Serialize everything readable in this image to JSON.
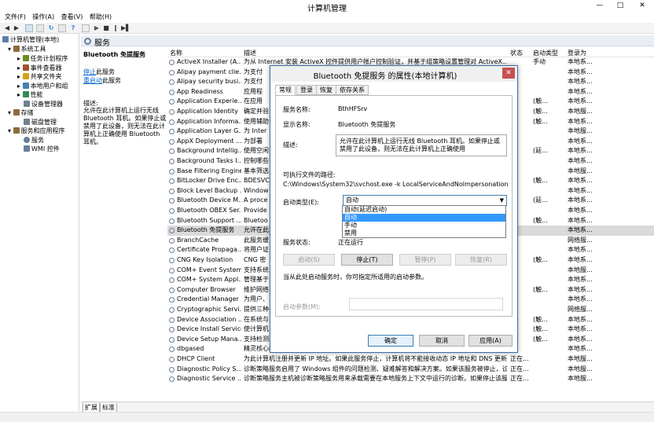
{
  "window": {
    "title": "计算机管理",
    "minimize": "—",
    "maximize": "□",
    "close": "✕"
  },
  "menu": [
    "文件(F)",
    "操作(A)",
    "查看(V)",
    "帮助(H)"
  ],
  "tree": [
    {
      "label": "计算机管理(本地)",
      "indent": 0,
      "color": "#5a7ea8"
    },
    {
      "label": "系统工具",
      "indent": 1,
      "color": "#8a6d3b"
    },
    {
      "label": "任务计划程序",
      "indent": 2,
      "color": "#6b8e23"
    },
    {
      "label": "事件查看器",
      "indent": 2,
      "color": "#a0522d"
    },
    {
      "label": "共享文件夹",
      "indent": 2,
      "color": "#d4a017"
    },
    {
      "label": "本地用户和组",
      "indent": 2,
      "color": "#4682b4"
    },
    {
      "label": "性能",
      "indent": 2,
      "color": "#2e8b57"
    },
    {
      "label": "设备管理器",
      "indent": 2,
      "color": "#708090"
    },
    {
      "label": "存储",
      "indent": 1,
      "color": "#8a6d3b"
    },
    {
      "label": "磁盘管理",
      "indent": 2,
      "color": "#708090"
    },
    {
      "label": "服务和应用程序",
      "indent": 1,
      "color": "#8a6d3b"
    },
    {
      "label": "服务",
      "indent": 2,
      "color": "#6a7f96"
    },
    {
      "label": "WMI 控件",
      "indent": 2,
      "color": "#6a7f96"
    }
  ],
  "services_header": "服务",
  "desc_panel": {
    "title": "Bluetooth 免提服务",
    "stop_link": "停止",
    "stop_suffix": "此服务",
    "restart_link": "重启动",
    "restart_suffix": "此服务",
    "desc_label": "描述:",
    "desc_text": "允许在此计算机上运行无线 Bluetooth 耳机。如果停止或禁用了此设备，则无法在此计算机上正确使用 Bluetooth 耳机。"
  },
  "columns": [
    "名称",
    "描述",
    "状态",
    "启动类型",
    "登录为"
  ],
  "services": [
    {
      "name": "ActiveX Installer (A...",
      "desc": "为从 Internet 安装 ActiveX 控件提供用户帐户控制验证，并基于组策略设置管理对 ActiveX...",
      "status": "",
      "startup": "手动",
      "logon": "本地系..."
    },
    {
      "name": "Alipay payment clie...",
      "desc": "为支付",
      "status": "",
      "startup": "",
      "logon": "本地系..."
    },
    {
      "name": "Alipay security busi...",
      "desc": "为支付",
      "status": "",
      "startup": "",
      "logon": "本地系..."
    },
    {
      "name": "App Readiness",
      "desc": "应用程",
      "status": "",
      "startup": "",
      "logon": "本地系..."
    },
    {
      "name": "Application Experie...",
      "desc": "在应用",
      "status": "",
      "startup": "(触...",
      "logon": "本地系..."
    },
    {
      "name": "Application Identity",
      "desc": "确定并验",
      "status": "",
      "startup": "(触...",
      "logon": "本地服..."
    },
    {
      "name": "Application Informa...",
      "desc": "使用辅助",
      "status": "",
      "startup": "(触...",
      "logon": "本地系..."
    },
    {
      "name": "Application Layer G...",
      "desc": "为 Inter",
      "status": "",
      "startup": "",
      "logon": "本地服..."
    },
    {
      "name": "AppX Deployment ...",
      "desc": "为部署",
      "status": "",
      "startup": "",
      "logon": "本地系..."
    },
    {
      "name": "Background Intellig...",
      "desc": "使用空闲",
      "status": "",
      "startup": "(延...",
      "logon": "本地系..."
    },
    {
      "name": "Background Tasks I...",
      "desc": "控制哪些",
      "status": "",
      "startup": "",
      "logon": "本地系..."
    },
    {
      "name": "Base Filtering Engine",
      "desc": "基本筛选",
      "status": "",
      "startup": "",
      "logon": "本地服..."
    },
    {
      "name": "BitLocker Drive Enc...",
      "desc": "BDESVC",
      "status": "",
      "startup": "(触...",
      "logon": "本地系..."
    },
    {
      "name": "Block Level Backup ...",
      "desc": "Window",
      "status": "",
      "startup": "",
      "logon": "本地系..."
    },
    {
      "name": "Bluetooth Device M...",
      "desc": "A proce",
      "status": "",
      "startup": "(延...",
      "logon": "本地系..."
    },
    {
      "name": "Bluetooth OBEX Ser...",
      "desc": "Provide",
      "status": "",
      "startup": "",
      "logon": "本地系..."
    },
    {
      "name": "Bluetooth Support ...",
      "desc": "Bluetoo",
      "status": "",
      "startup": "(触...",
      "logon": "本地系..."
    },
    {
      "name": "Bluetooth 免提服务",
      "desc": "允许在此",
      "status": "",
      "startup": "",
      "logon": "本地系..."
    },
    {
      "name": "BranchCache",
      "desc": "此服务缓",
      "status": "",
      "startup": "",
      "logon": "网络服..."
    },
    {
      "name": "Certificate Propaga...",
      "desc": "将用户证",
      "status": "",
      "startup": "",
      "logon": "本地系..."
    },
    {
      "name": "CNG Key Isolation",
      "desc": "CNG 密",
      "status": "",
      "startup": "(触...",
      "logon": "本地系..."
    },
    {
      "name": "COM+ Event System",
      "desc": "支持系统",
      "status": "",
      "startup": "",
      "logon": "本地服..."
    },
    {
      "name": "COM+ System Appl...",
      "desc": "管理基于",
      "status": "",
      "startup": "",
      "logon": "本地系..."
    },
    {
      "name": "Computer Browser",
      "desc": "维护网络",
      "status": "",
      "startup": "(触...",
      "logon": "本地系..."
    },
    {
      "name": "Credential Manager",
      "desc": "为用户、",
      "status": "",
      "startup": "",
      "logon": "本地系..."
    },
    {
      "name": "Cryptographic Servi...",
      "desc": "提供三种",
      "status": "",
      "startup": "",
      "logon": "网络服..."
    },
    {
      "name": "Device Association ...",
      "desc": "在系统与",
      "status": "",
      "startup": "(触...",
      "logon": "本地系..."
    },
    {
      "name": "Device Install Service",
      "desc": "使计算机",
      "status": "",
      "startup": "(触...",
      "logon": "本地系..."
    },
    {
      "name": "Device Setup Mana...",
      "desc": "支持检测、下载和安装与设备相关的软件。如果此服务被禁用，则可能使用过期软件对设备进...",
      "status": "",
      "startup": "(触...",
      "logon": "本地系..."
    },
    {
      "name": "dbgased",
      "desc": "精灵核心组件服务，包括程序完整性校验，服务唤醒，服务通信。",
      "status": "",
      "startup": "",
      "logon": "本地系..."
    },
    {
      "name": "DHCP Client",
      "desc": "为此计算机注册并更新 IP 地址。如果此服务停止，计算机将不能接收动态 IP 地址和 DNS 更新...",
      "status": "正在...",
      "startup": "",
      "logon": "本地服..."
    },
    {
      "name": "Diagnostic Policy S...",
      "desc": "诊断策略服务启用了 Windows 组件的问题检测、疑难解答和解决方案。如果该服务被停止，诊...",
      "status": "正在...",
      "startup": "",
      "logon": "本地服..."
    },
    {
      "name": "Diagnostic Service ...",
      "desc": "诊断策略服务主机被诊断策略服务用来承载需要在本地服务上下文中运行的诊断。如果停止该服务...",
      "status": "正在...",
      "startup": "",
      "logon": "本地服..."
    }
  ],
  "bottom_tabs": [
    "扩展",
    "标准"
  ],
  "dialog": {
    "title": "Bluetooth 免提服务 的属性(本地计算机)",
    "close": "✕",
    "tabs": [
      "常规",
      "登录",
      "恢复",
      "依存关系"
    ],
    "service_name_label": "服务名称:",
    "service_name": "BthHFSrv",
    "display_name_label": "显示名称:",
    "display_name": "Bluetooth 免提服务",
    "desc_label": "描述:",
    "desc": "允许在此计算机上运行无线 Bluetooth 耳机。如果停止或禁用了此设备，则无法在此计算机上正确使用",
    "path_label": "可执行文件的路径:",
    "path": "C:\\Windows\\System32\\svchost.exe -k LocalServiceAndNoImpersonation",
    "startup_label": "启动类型(E):",
    "startup_value": "自动",
    "startup_options": [
      "自动(延迟启动)",
      "自动",
      "手动",
      "禁用"
    ],
    "startup_highlight": 1,
    "status_label": "服务状态:",
    "status_value": "正在运行",
    "btn_start": "启动(S)",
    "btn_stop": "停止(T)",
    "btn_pause": "暂停(P)",
    "btn_resume": "恢复(R)",
    "hint": "当从此处启动服务时，你可指定所适用的启动参数。",
    "param_label": "启动参数(M):",
    "ok": "确定",
    "cancel": "取消",
    "apply": "应用(A)"
  }
}
